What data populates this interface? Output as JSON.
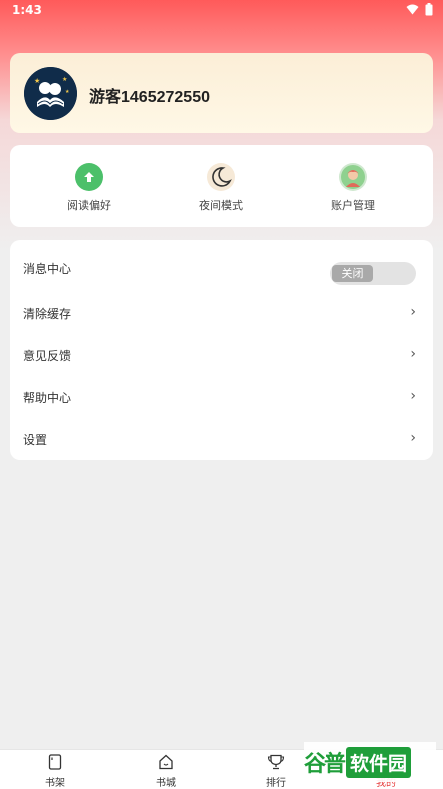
{
  "status_bar": {
    "time": "1:43"
  },
  "user": {
    "name": "游客1465272550"
  },
  "quick_actions": [
    {
      "label": "阅读偏好",
      "icon": "arrow-up-circle-icon",
      "color": "#4cc06a"
    },
    {
      "label": "夜间模式",
      "icon": "moon-icon",
      "color": "#f6e9d7"
    },
    {
      "label": "账户管理",
      "icon": "user-avatar-icon",
      "color": "#8fd18f"
    }
  ],
  "menu": {
    "items": [
      {
        "label": "消息中心",
        "toggle_label": "关闭"
      },
      {
        "label": "清除缓存",
        "chevron": "›"
      },
      {
        "label": "意见反馈",
        "chevron": "›"
      },
      {
        "label": "帮助中心",
        "chevron": "›"
      },
      {
        "label": "设置",
        "chevron": "›"
      }
    ]
  },
  "tabbar": {
    "tabs": [
      {
        "label": "书架"
      },
      {
        "label": "书城"
      },
      {
        "label": "排行"
      },
      {
        "label": "我的"
      }
    ],
    "active_color": "#e63b3b"
  },
  "watermark": {
    "logo": "谷普",
    "text": "软件园"
  }
}
